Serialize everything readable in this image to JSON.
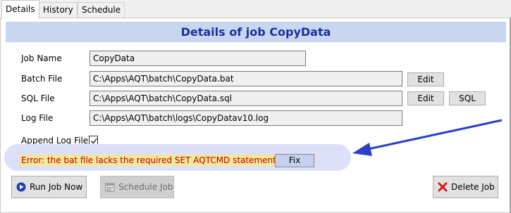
{
  "tabs": [
    {
      "label": "Details"
    },
    {
      "label": "History"
    },
    {
      "label": "Schedule"
    }
  ],
  "header": {
    "title": "Details of job CopyData"
  },
  "form": {
    "job_name": {
      "label": "Job Name",
      "value": "CopyData"
    },
    "batch_file": {
      "label": "Batch File",
      "value": "C:\\Apps\\AQT\\batch\\CopyData.bat",
      "edit_label": "Edit"
    },
    "sql_file": {
      "label": "SQL File",
      "value": "C:\\Apps\\AQT\\batch\\CopyData.sql",
      "edit_label": "Edit",
      "sql_label": "SQL"
    },
    "log_file": {
      "label": "Log File",
      "value": "C:\\Apps\\AQT\\batch\\logs\\CopyDatav10.log"
    },
    "append_log": {
      "label": "Append Log File",
      "checked": true
    }
  },
  "error": {
    "message": "Error: the bat file lacks the required SET AQTCMD statement",
    "fix_label": "Fix"
  },
  "actions": {
    "run_label": "Run Job Now",
    "schedule_label": "Schedule Job",
    "delete_label": "Delete Job"
  },
  "colors": {
    "header_bg": "#c9d6f0",
    "header_text": "#1c2fa0",
    "error_text": "#c00000",
    "error_bg": "#f3e79a",
    "arrow": "#2a3fc8"
  }
}
